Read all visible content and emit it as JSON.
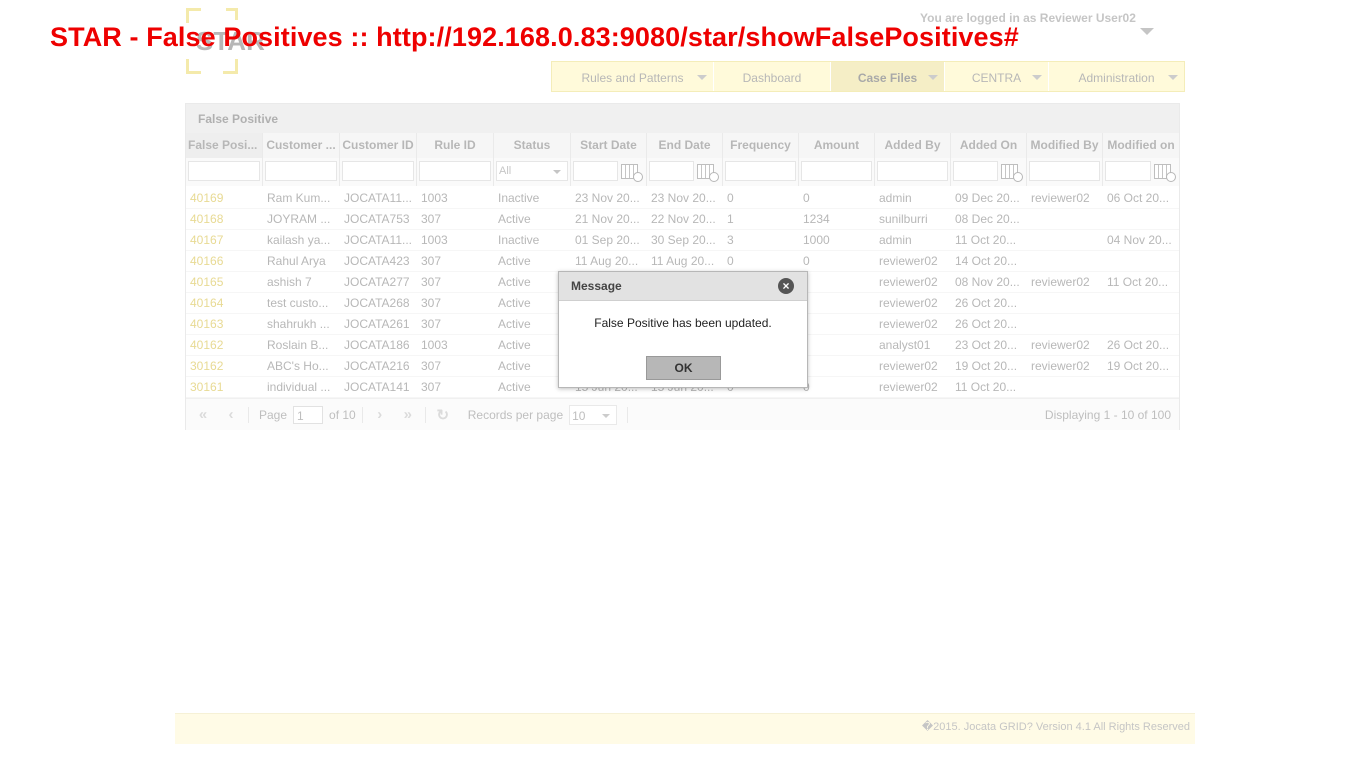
{
  "overlay_title": "STAR - False Positives :: http://192.168.0.83:9080/star/showFalsePositives#",
  "header": {
    "logo_text": "STAR",
    "login_text": "You are logged in as Reviewer User02"
  },
  "nav": [
    {
      "label": "Rules and Patterns",
      "dropdown": true
    },
    {
      "label": "Dashboard",
      "dropdown": false
    },
    {
      "label": "Case Files",
      "dropdown": true
    },
    {
      "label": "CENTRA",
      "dropdown": true
    },
    {
      "label": "Administration",
      "dropdown": true
    }
  ],
  "panel": {
    "title": "False Positive"
  },
  "grid": {
    "columns": [
      "False Posi...",
      "Customer ...",
      "Customer ID",
      "Rule ID",
      "Status",
      "Start Date",
      "End Date",
      "Frequency",
      "Amount",
      "Added By",
      "Added On",
      "Modified By",
      "Modified on"
    ],
    "status_filter": "All",
    "rows": [
      [
        "40169",
        "Ram Kum...",
        "JOCATA11...",
        "1003",
        "Inactive",
        "23 Nov 20...",
        "23 Nov 20...",
        "0",
        "0",
        "admin",
        "09 Dec 20...",
        "reviewer02",
        "06 Oct 20..."
      ],
      [
        "40168",
        "JOYRAM ...",
        "JOCATA753",
        "307",
        "Active",
        "21 Nov 20...",
        "22 Nov 20...",
        "1",
        "1234",
        "sunilburri",
        "08 Dec 20...",
        "",
        ""
      ],
      [
        "40167",
        "kailash ya...",
        "JOCATA11...",
        "1003",
        "Inactive",
        "01 Sep 20...",
        "30 Sep 20...",
        "3",
        "1000",
        "admin",
        "11 Oct 20...",
        "",
        "04 Nov 20..."
      ],
      [
        "40166",
        "Rahul Arya",
        "JOCATA423",
        "307",
        "Active",
        "11 Aug 20...",
        "11 Aug 20...",
        "0",
        "0",
        "reviewer02",
        "14 Oct 20...",
        "",
        ""
      ],
      [
        "40165",
        "ashish 7",
        "JOCATA277",
        "307",
        "Active",
        "",
        "",
        "",
        "",
        "reviewer02",
        "08 Nov 20...",
        "reviewer02",
        "11 Oct 20..."
      ],
      [
        "40164",
        "test custo...",
        "JOCATA268",
        "307",
        "Active",
        "",
        "",
        "",
        "",
        "reviewer02",
        "26 Oct 20...",
        "",
        ""
      ],
      [
        "40163",
        "shahrukh ...",
        "JOCATA261",
        "307",
        "Active",
        "",
        "",
        "",
        "",
        "reviewer02",
        "26 Oct 20...",
        "",
        ""
      ],
      [
        "40162",
        "Roslain B...",
        "JOCATA186",
        "1003",
        "Active",
        "",
        "",
        "",
        "",
        "analyst01",
        "23 Oct 20...",
        "reviewer02",
        "26 Oct 20..."
      ],
      [
        "30162",
        "ABC's Ho...",
        "JOCATA216",
        "307",
        "Active",
        "",
        "",
        "",
        "",
        "reviewer02",
        "19 Oct 20...",
        "reviewer02",
        "19 Oct 20..."
      ],
      [
        "30161",
        "individual ...",
        "JOCATA141",
        "307",
        "Active",
        "15 Jun 20...",
        "15 Jun 20...",
        "0",
        "0",
        "reviewer02",
        "11 Oct 20...",
        "",
        ""
      ]
    ]
  },
  "pager": {
    "page_label": "Page",
    "page_value": "1",
    "of_label": "of 10",
    "records_label": "Records per page",
    "records_value": "10",
    "display_text": "Displaying 1 - 10 of 100"
  },
  "footer": {
    "text": "�2015. Jocata GRID? Version 4.1 All Rights Reserved"
  },
  "modal": {
    "title": "Message",
    "message": "False Positive has been updated.",
    "ok_label": "OK"
  }
}
